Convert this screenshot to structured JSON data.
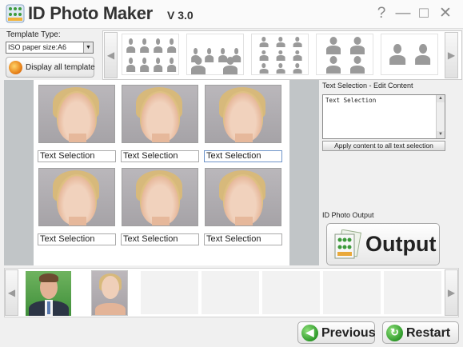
{
  "window": {
    "title": "ID Photo Maker",
    "version": "V 3.0",
    "help_glyph": "?",
    "minimize_glyph": "—",
    "maximize_glyph": "□",
    "close_glyph": "✕"
  },
  "template": {
    "label": "Template Type:",
    "selected": "ISO paper size:A6",
    "display_all_label": "Display all template",
    "left_arrow": "◀",
    "right_arrow": "▶"
  },
  "canvas": {
    "text_fields": [
      "Text Selection",
      "Text Selection",
      "Text Selection",
      "Text Selection",
      "Text Selection",
      "Text Selection"
    ]
  },
  "edit_panel": {
    "title": "Text Selection - Edit Content",
    "content": "Text Selection",
    "apply_label": "Apply content to all text selection"
  },
  "output_panel": {
    "title": "ID Photo Output",
    "button_label": "Output"
  },
  "photo_strip": {
    "left_arrow": "◀",
    "right_arrow": "▶"
  },
  "footer": {
    "previous_label": "Previous",
    "restart_label": "Restart"
  },
  "colors": {
    "accent_green": "#2f9a2a",
    "canvas_frame": "#c1c5c7",
    "photo_bg": "#bab7bb"
  }
}
